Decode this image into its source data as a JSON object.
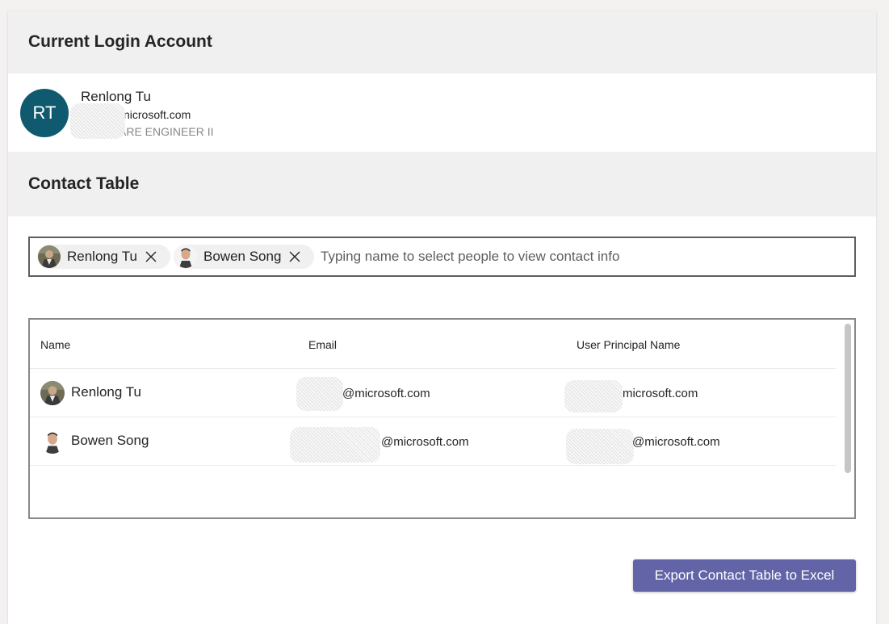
{
  "account_section": {
    "title": "Current Login Account",
    "initials": "RT",
    "name": "Renlong Tu",
    "email_visible": "nicrosoft.com",
    "job_title_visible": "ARE ENGINEER II"
  },
  "contact_section": {
    "title": "Contact Table",
    "picker": {
      "chips": [
        {
          "label": "Renlong Tu",
          "photo": "person-photo"
        },
        {
          "label": "Bowen Song",
          "photo": "person-photo"
        }
      ],
      "placeholder": "Typing name to select people to view contact info"
    },
    "table": {
      "columns": [
        "Name",
        "Email",
        "User Principal Name"
      ],
      "rows": [
        {
          "name": "Renlong Tu",
          "email": "@microsoft.com",
          "upn": "microsoft.com"
        },
        {
          "name": "Bowen Song",
          "email": "@microsoft.com",
          "upn": "@microsoft.com"
        }
      ]
    },
    "export_label": "Export Contact Table to Excel"
  },
  "colors": {
    "avatar_bg": "#0f5a6e",
    "button_bg": "#6264a7",
    "header_bg": "#f0f0f0"
  }
}
